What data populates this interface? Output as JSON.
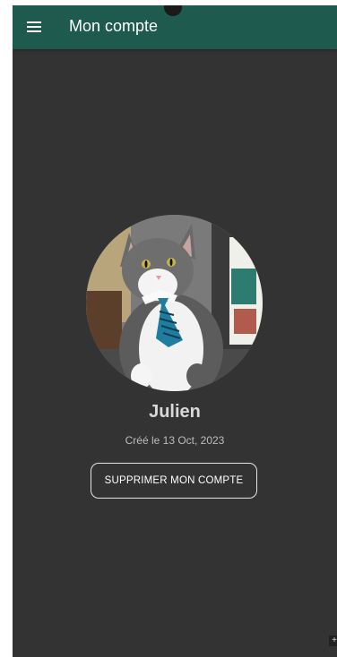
{
  "header": {
    "title": "Mon compte",
    "menu_icon": "hamburger-menu-icon"
  },
  "profile": {
    "avatar_alt": "photo de profil",
    "name": "Julien",
    "created": "Créé le 13 Oct, 2023"
  },
  "actions": {
    "delete_label": "SUPPRIMER MON COMPTE"
  },
  "colors": {
    "appbar": "#1e5a4e",
    "background": "#333333",
    "text": "#ffffff"
  }
}
